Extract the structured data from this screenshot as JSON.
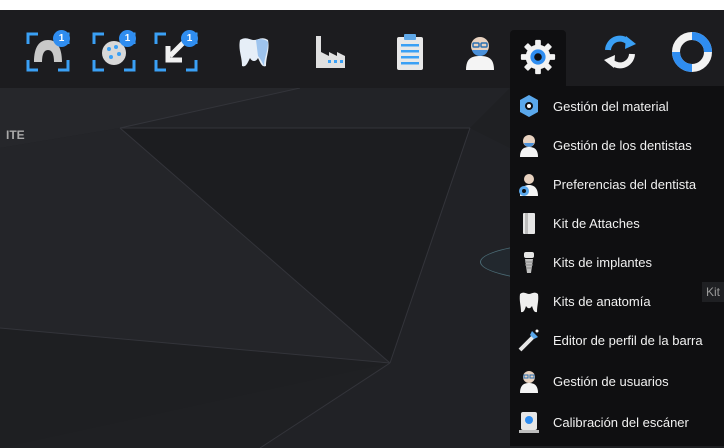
{
  "toolbar": {
    "buttons": [
      {
        "icon": "dental-arch-scan-icon",
        "badge": "1"
      },
      {
        "icon": "model-scan-icon",
        "badge": "1"
      },
      {
        "icon": "import-arrow-icon",
        "badge": "1"
      },
      {
        "icon": "tooth-icon"
      },
      {
        "icon": "factory-icon"
      },
      {
        "icon": "clipboard-icon"
      },
      {
        "icon": "dentist-icon"
      },
      {
        "icon": "gear-icon",
        "active": true
      },
      {
        "icon": "refresh-icon"
      },
      {
        "icon": "lifebuoy-icon"
      }
    ]
  },
  "left_label": "ITE",
  "settings_menu": {
    "items": [
      {
        "label": "Gestión del material",
        "icon": "material-icon"
      },
      {
        "label": "Gestión de los dentistas",
        "icon": "dentist-icon"
      },
      {
        "label": "Preferencias del dentista",
        "icon": "dentist-preferences-icon"
      },
      {
        "label": "Kit de Attaches",
        "icon": "attachment-kit-icon"
      },
      {
        "label": "Kits de implantes",
        "icon": "implant-icon",
        "hovered": true
      },
      {
        "label": "Kits de anatomía",
        "icon": "tooth-anatomy-icon"
      },
      {
        "label": "Editor de perfil de la barra",
        "icon": "bar-profile-icon"
      },
      {
        "label": "Gestión de usuarios",
        "icon": "user-icon"
      },
      {
        "label": "Calibración del escáner",
        "icon": "scanner-calibration-icon"
      }
    ]
  },
  "tooltip": "Kit",
  "colors": {
    "accent": "#2f8df0",
    "menu_bg": "#0f0f11",
    "background": "#1f2023"
  }
}
